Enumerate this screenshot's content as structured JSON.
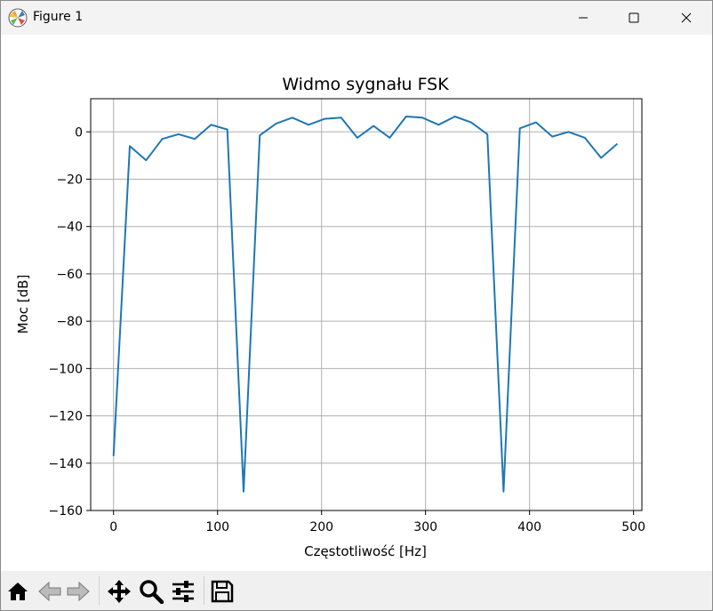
{
  "window": {
    "title": "Figure 1"
  },
  "chart_data": {
    "type": "line",
    "title": "Widmo sygnału FSK",
    "xlabel": "Częstotliwość [Hz]",
    "ylabel": "Moc [dB]",
    "xlim": [
      -22,
      508
    ],
    "ylim": [
      -160,
      14
    ],
    "xticks": [
      0,
      100,
      200,
      300,
      400,
      500
    ],
    "yticks": [
      0,
      -20,
      -40,
      -60,
      -80,
      -100,
      -120,
      -140,
      -160
    ],
    "xtick_labels": [
      "0",
      "100",
      "200",
      "300",
      "400",
      "500"
    ],
    "ytick_labels": [
      "0",
      "−20",
      "−40",
      "−60",
      "−80",
      "−100",
      "−120",
      "−140",
      "−160"
    ],
    "grid": true,
    "line_color": "#1f77b4",
    "series": [
      {
        "x": [
          0,
          15.6,
          31.3,
          46.9,
          62.5,
          78.1,
          93.8,
          109.4,
          125,
          140.6,
          156.3,
          171.9,
          187.5,
          203.1,
          218.8,
          234.4,
          250,
          265.6,
          281.3,
          296.9,
          312.5,
          328.1,
          343.8,
          359.4,
          375,
          390.6,
          406.3,
          421.9,
          437.5,
          453.1,
          468.8,
          484.4
        ],
        "y": [
          -137,
          -6,
          -12,
          -3,
          -1,
          -3,
          3,
          1,
          -152,
          -1.5,
          3.5,
          6,
          3,
          5.5,
          6,
          -2.5,
          2.5,
          -2.5,
          6.5,
          6,
          3,
          6.5,
          4,
          -1,
          -152,
          1.5,
          4,
          -2,
          0,
          -2.5,
          -11,
          -5
        ]
      }
    ]
  },
  "toolbar": {
    "tools": [
      {
        "name": "home-icon"
      },
      {
        "name": "back-arrow-icon"
      },
      {
        "name": "forward-arrow-icon"
      },
      {
        "name": "pan-icon"
      },
      {
        "name": "zoom-icon"
      },
      {
        "name": "configure-subplots-icon"
      },
      {
        "name": "save-icon"
      }
    ]
  }
}
